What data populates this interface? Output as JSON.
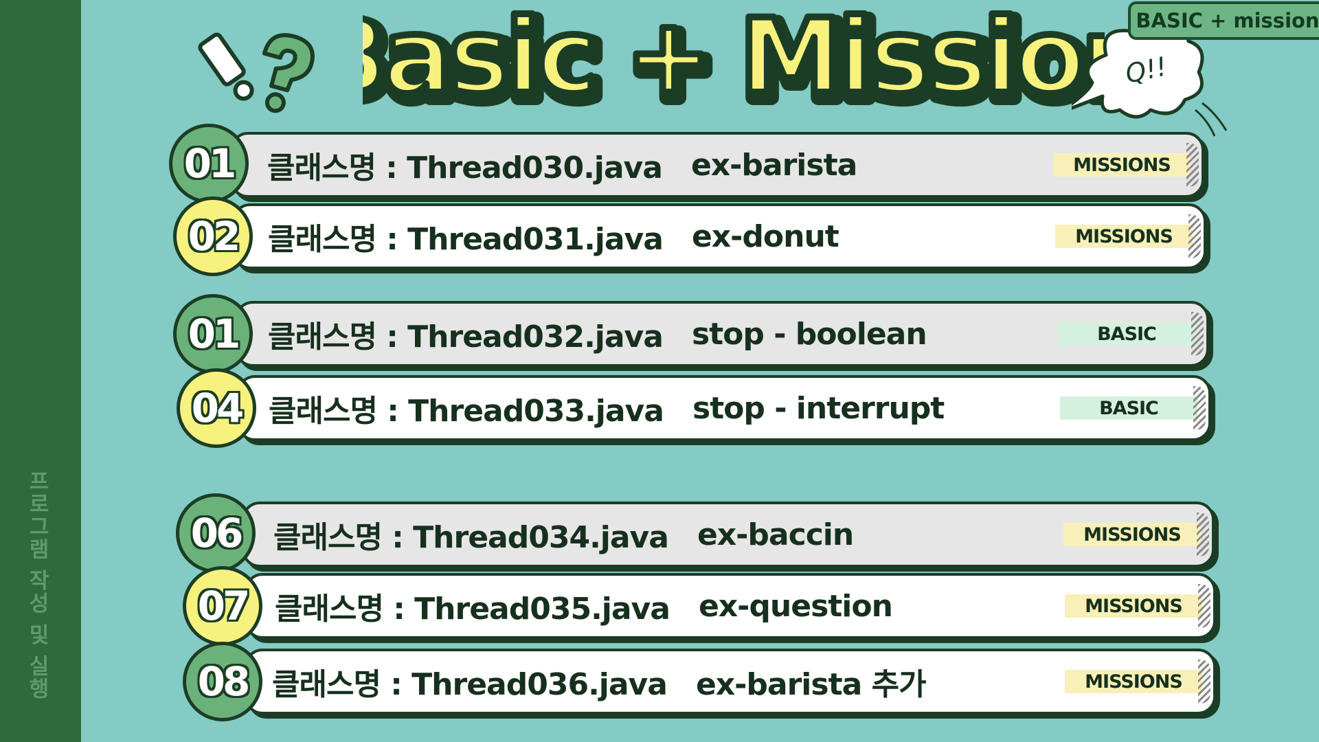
{
  "title": "Basic + Mission",
  "top_tag": "BASIC + mission",
  "bubble_text": "Q!!",
  "sidebar_text": "프로그램 작성 및 실행",
  "colors": {
    "background": "#83cbc4",
    "sidebar": "#2d6b3c",
    "title_fill": "#f7f17e",
    "badge_green": "#6bb27a",
    "badge_yellow": "#f7f17e",
    "mission_tag": "#f8f0b8",
    "basic_tag": "#d4f1df"
  },
  "rows": [
    {
      "num": "01",
      "cls": "클래스명 : Thread030.java",
      "desc": "ex-barista",
      "tag": "MISSIONS"
    },
    {
      "num": "02",
      "cls": "클래스명 : Thread031.java",
      "desc": "ex-donut",
      "tag": "MISSIONS"
    },
    {
      "num": "01",
      "cls": "클래스명 : Thread032.java",
      "desc": "stop - boolean",
      "tag": "BASIC"
    },
    {
      "num": "04",
      "cls": "클래스명 : Thread033.java",
      "desc": "stop - interrupt",
      "tag": "BASIC"
    },
    {
      "num": "06",
      "cls": "클래스명 : Thread034.java",
      "desc": "ex-baccin",
      "tag": "MISSIONS"
    },
    {
      "num": "07",
      "cls": "클래스명 : Thread035.java",
      "desc": "ex-question",
      "tag": "MISSIONS"
    },
    {
      "num": "08",
      "cls": "클래스명 : Thread036.java",
      "desc": "ex-barista 추가",
      "tag": "MISSIONS"
    }
  ]
}
